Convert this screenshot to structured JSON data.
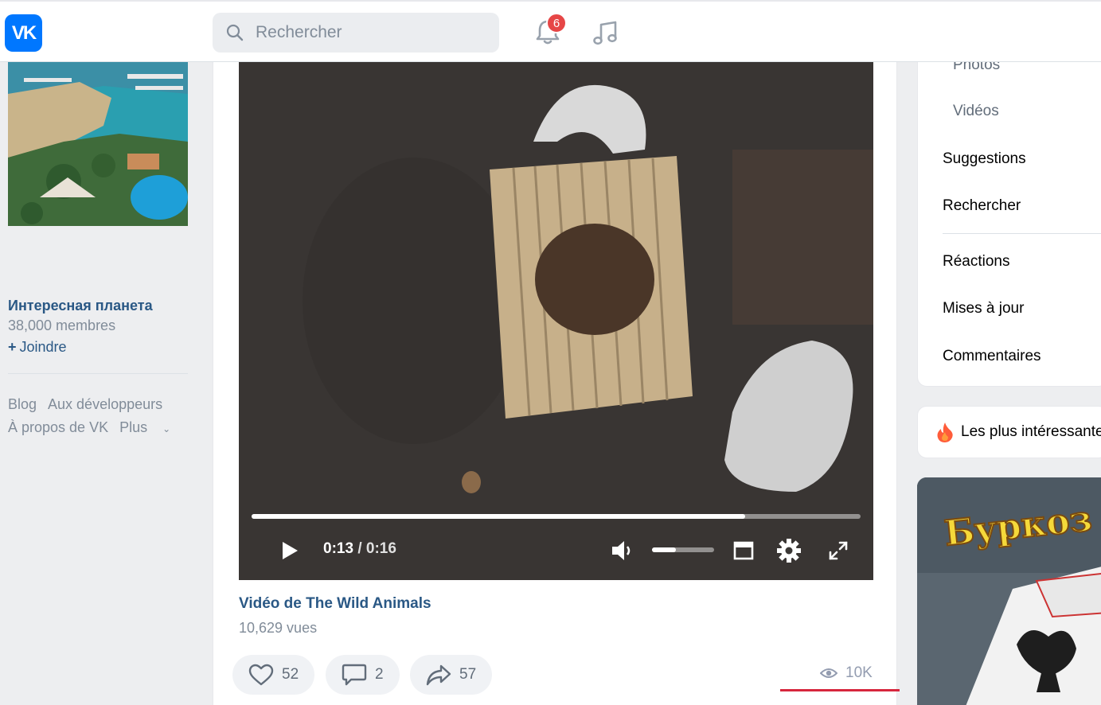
{
  "header": {
    "logo_text": "VK",
    "search_placeholder": "Rechercher",
    "notifications_count": "6"
  },
  "left": {
    "group_name": "Интересная планета",
    "group_members": "38,000 membres",
    "join_label": "Joindre",
    "footer_links": [
      "Blog",
      "Aux développeurs",
      "À propos de VK",
      "Plus"
    ]
  },
  "post": {
    "video": {
      "current_time": "0:13",
      "separator": "/",
      "duration": "0:16",
      "progress_fraction": 0.81,
      "volume_fraction": 0.38
    },
    "title": "Vidéo de The Wild Animals",
    "views_text": "10,629 vues",
    "likes": "52",
    "comments": "2",
    "shares": "57",
    "views_short": "10K"
  },
  "right": {
    "menu": {
      "photos": "Photos",
      "videos": "Vidéos",
      "suggestions": "Suggestions",
      "search": "Rechercher",
      "reactions": "Réactions",
      "updates": "Mises à jour",
      "comments": "Commentaires"
    },
    "trending_label": "Les plus intéressantes",
    "promo_title": "Буркоз"
  },
  "colors": {
    "accent": "#0077ff",
    "link": "#2a5885",
    "badge": "#e64646",
    "underline": "#d7263d"
  }
}
